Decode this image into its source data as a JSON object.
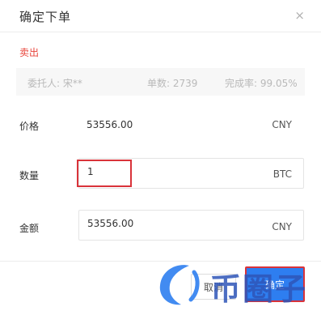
{
  "dialog": {
    "title": "确定下单",
    "close_glyph": "×",
    "side_label": "卖出"
  },
  "merchant": {
    "owner": "委托人: 宋**",
    "orders": "单数: 2739",
    "completion": "完成率: 99.05%"
  },
  "form": {
    "price": {
      "label": "价格",
      "value": "53556.00",
      "unit": "CNY"
    },
    "quantity": {
      "label": "数量",
      "value": "1",
      "unit": "BTC"
    },
    "amount": {
      "label": "金额",
      "value": "53556.00",
      "unit": "CNY"
    }
  },
  "buttons": {
    "cancel": "取消",
    "confirm": "确定"
  },
  "watermark": {
    "text": "币圈子"
  },
  "colors": {
    "accent": "#2e7ef0",
    "sell_red": "#e8453c",
    "highlight_red": "#d9333a",
    "watermark_blue": "#2e55b8"
  }
}
